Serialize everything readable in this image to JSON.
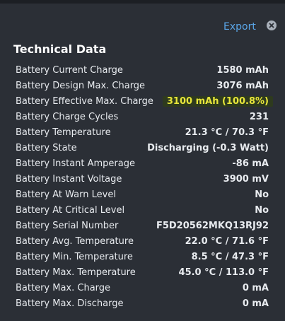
{
  "header": {
    "export_label": "Export",
    "close_icon": "close-icon",
    "title": "Technical Data"
  },
  "colors": {
    "background": "#2b2f36",
    "link": "#5aa6e8",
    "highlight": "#e8e63a"
  },
  "rows": [
    {
      "label": "Battery Current Charge",
      "value": "1580 mAh"
    },
    {
      "label": "Battery Design Max. Charge",
      "value": "3076 mAh"
    },
    {
      "label": "Battery Effective Max. Charge",
      "value": "3100 mAh (100.8%)"
    },
    {
      "label": "Battery Charge Cycles",
      "value": "231"
    },
    {
      "label": "Battery Temperature",
      "value": "21.3 °C / 70.3 °F"
    },
    {
      "label": "Battery State",
      "value": "Discharging (-0.3 Watt)"
    },
    {
      "label": "Battery Instant Amperage",
      "value": "-86 mA"
    },
    {
      "label": "Battery Instant Voltage",
      "value": "3900 mV"
    },
    {
      "label": "Battery At Warn Level",
      "value": "No"
    },
    {
      "label": "Battery At Critical Level",
      "value": "No"
    },
    {
      "label": "Battery Serial Number",
      "value": "F5D20562MKQ13RJ92"
    },
    {
      "label": "Battery Avg. Temperature",
      "value": "22.0 °C / 71.6 °F"
    },
    {
      "label": "Battery Min. Temperature",
      "value": "8.5 °C / 47.3 °F"
    },
    {
      "label": "Battery Max. Temperature",
      "value": "45.0 °C / 113.0 °F"
    },
    {
      "label": "Battery Max. Charge",
      "value": "0 mA"
    },
    {
      "label": "Battery Max. Discharge",
      "value": "0 mA"
    }
  ]
}
